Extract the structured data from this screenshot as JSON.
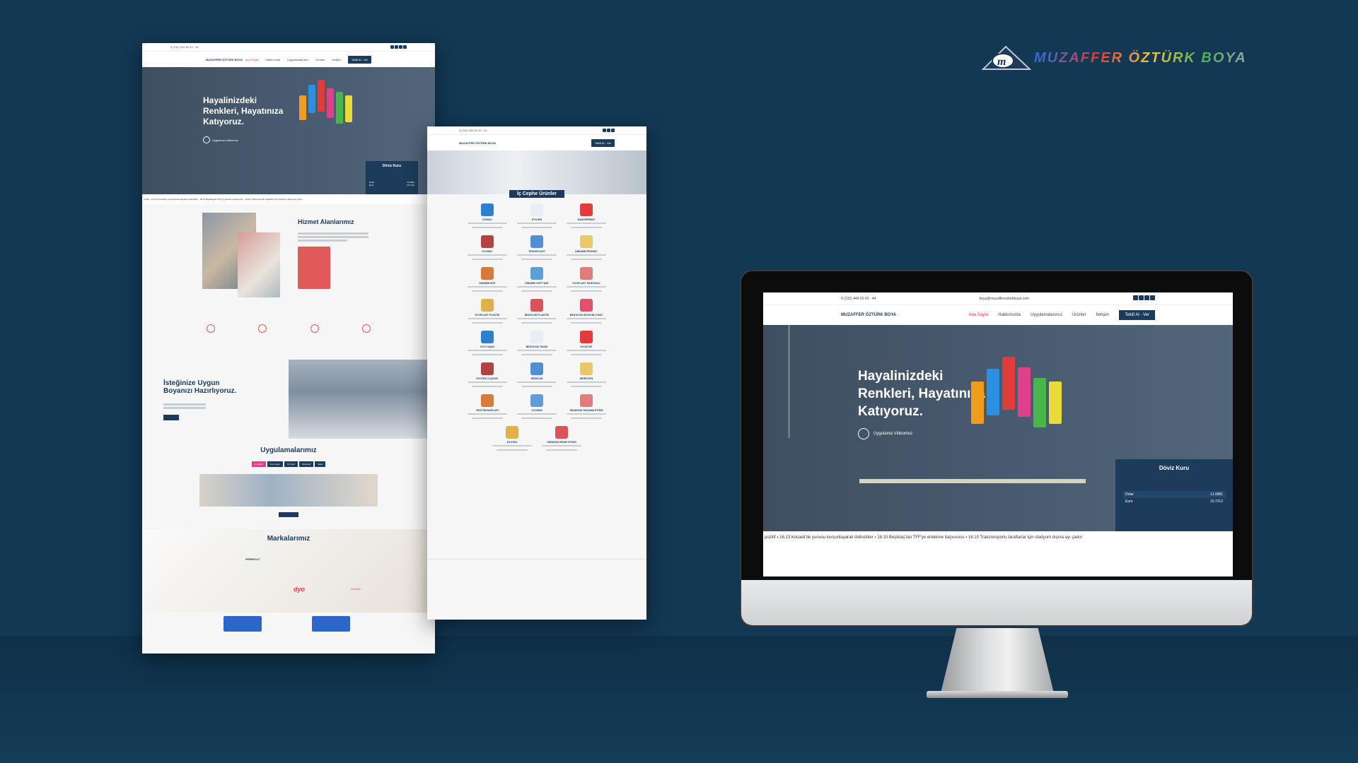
{
  "brand": {
    "logo_text": "MUZAFFER ÖZTÜRK BOYA",
    "colors": {
      "background": "#123854",
      "navy": "#1b3a5c",
      "accent": "#e23b3b"
    }
  },
  "topbar": {
    "phone": "0 (232) 449 60 43 - 44",
    "email": "boya@muzafferozturkboya.com",
    "social": [
      "facebook-icon",
      "twitter-icon",
      "instagram-icon",
      "linkedin-icon"
    ]
  },
  "nav": {
    "items": [
      "Ana Sayfa",
      "Hakkımızda",
      "Uygulamalarımız",
      "Ürünler",
      "İletişim"
    ],
    "active": "Ana Sayfa",
    "cta": "Teklif Al - Ver"
  },
  "hero": {
    "line1": "Hayalinizdeki",
    "line2": "Renkleri, Hayatınıza",
    "line3": "Katıyoruz.",
    "video_label": "Uygulama Videomuz"
  },
  "currency": {
    "title": "Döviz Kuru",
    "rows": [
      {
        "name": "Dolar",
        "value": "11.0881"
      },
      {
        "name": "Euro",
        "value": "15.7212"
      }
    ]
  },
  "ticker": [
    "pozitif",
    "16:13 Kocaeli'de yunusu kurşunlayarak öldürdüler",
    "16:10 Beşiktaş'tan TFF'ye erteleme başvurusu",
    "16:10 Trabzonsporlu taraftarlar için stadyum dışına ayı çadırı"
  ],
  "sections": {
    "services": "Hizmet Alanlarımız",
    "ready": "İsteğinize Uygun Boyanızı Hazırlıyoruz.",
    "applications": "Uygulamalarımız",
    "brands": "Markalarımız",
    "interior": "İç Cephe Ürünler"
  },
  "app_tabs": [
    "İç Cephe",
    "Dış Cephe",
    "Yer Şerit",
    "Dekoratif",
    "Metal"
  ],
  "brand_logos": [
    "dyo",
    "PERMOLIT",
    "Dewilux"
  ],
  "products": [
    "DIYMAX",
    "DYOJEN",
    "NANOPERMAT",
    "DYOMAT",
    "TEKNOPLAST",
    "DİNAMİK İPEKMAT",
    "DİNAMİK MAT",
    "DİNAMİK SOFT MAT",
    "DYOPLAST SİLİKONLU",
    "DYOPLAST PLASTİK",
    "BEŞYILDIZ PLASTİK",
    "BEŞYILDIZ SİLİKONLU MAT",
    "DYO TAVAN",
    "BEŞYILDIZ TAVAN",
    "DYOSTOP",
    "DYOTEN CLASSIC",
    "HİDROLİN",
    "HİDROTEN",
    "YENİ TEKNOPLAST",
    "DYONEM",
    "SENKRON YIKANMA ETKİSİ",
    "DYOTEK",
    "SENKRON REDIF ETKİSİ"
  ]
}
